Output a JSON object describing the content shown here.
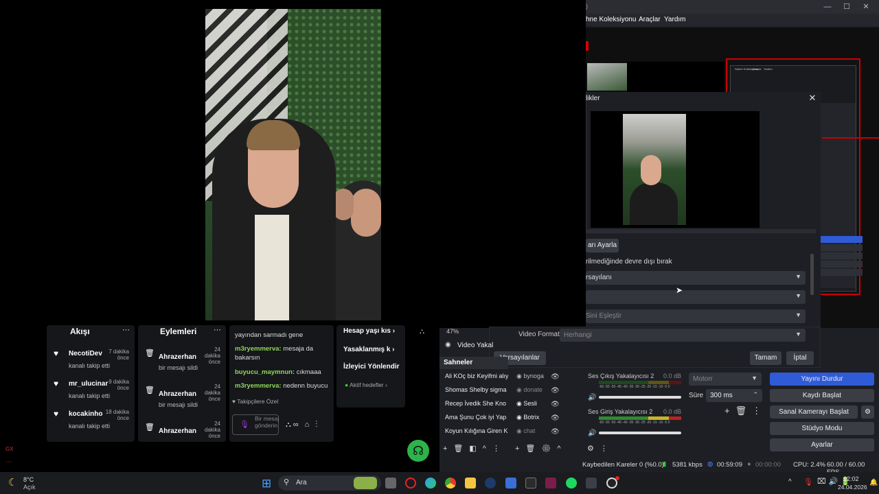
{
  "obs": {
    "menu": [
      "hne Koleksiyonu",
      "Araçlar",
      "Yardım"
    ],
    "window_controls": [
      "—",
      "☐",
      "✕"
    ],
    "nested_menu": [
      "Sahne Koleksiyonu",
      "Araçlar",
      "Yardım"
    ]
  },
  "dialog": {
    "title": "likler",
    "reset_button": "arı Ayarla",
    "checkbox_label": "rilmediğinde devre dışı bırak",
    "select1": "rsayılanı",
    "select2": "",
    "select3": "Sini Eşleştir",
    "video_format_label": "Video Formatı",
    "video_format_value": "Herhangi",
    "defaults_button": "Varsayılanlar",
    "ok_button": "Tamam",
    "cancel_button": "İptal"
  },
  "panels": {
    "follows": {
      "title": "Akışı",
      "items": [
        {
          "name": "NecotiDev",
          "action": "kanalı takip etti",
          "time": "7 dakika önce"
        },
        {
          "name": "mr_ulucinar",
          "action": "kanalı takip etti",
          "time": "9 dakika önce"
        },
        {
          "name": "kocakinho",
          "action": "kanalı takip etti",
          "time": "18 dakika önce"
        }
      ]
    },
    "actions": {
      "title": "Eylemleri",
      "items": [
        {
          "name": "Ahrazerhan",
          "action": "bir mesajı sildi",
          "time": "24 dakika önce"
        },
        {
          "name": "Ahrazerhan",
          "action": "bir mesajı sildi",
          "time": "24 dakika önce"
        },
        {
          "name": "Ahrazerhan",
          "action": "",
          "time": "24 dakika önce"
        }
      ]
    },
    "chat": {
      "messages": [
        {
          "user": "",
          "text": "yayından sarmadı gene"
        },
        {
          "user": "m3ryemmerva:",
          "text": "mesaja da bakarsın"
        },
        {
          "user": "buyucu_maymnun:",
          "text": "cıkmaaa"
        },
        {
          "user": "m3ryemmerva:",
          "text": "nedenn buyucu"
        }
      ],
      "followers_only": "Takipçilere Özel",
      "input_placeholder": "Bir mesaj gönderin"
    },
    "mod": {
      "items": [
        "Hesap yaşı kıs",
        "Yasaklanmış k",
        "İzleyici Yönlendir"
      ],
      "active_filters": "Aktif hedefler"
    }
  },
  "dock": {
    "preview_label": "Video Yakal",
    "scenes_title": "Sahneler",
    "scenes": [
      "Ali KOç biz Keyifmi alıy",
      "Shomas Shelby sigma",
      "Recep İvedik She Kno",
      "Ama Şunu Çok iyi Yap",
      "Koyun Kılığına Giren K"
    ],
    "sources": [
      "bynoga",
      "donate",
      "Sesli",
      "Botrix",
      "chat"
    ],
    "zoom": "47%",
    "mixer": [
      {
        "name": "Ses Çıkış Yakalayıcısı 2",
        "db": "0.0 dB"
      },
      {
        "name": "Ses Giriş Yakalayıcısı 2",
        "db": "0.0 dB"
      }
    ],
    "meter_ticks": "-60 -55 -50 -45 -40 -35 -30 -25 -20 -15 -10 -5 0",
    "transition": "Motorr",
    "duration_label": "Süre",
    "duration_value": "300 ms",
    "controls": [
      "Yayını Durdur",
      "Kaydı Başlat",
      "Sanal Kamerayı Başlat",
      "Stüdyo Modu",
      "Ayarlar"
    ]
  },
  "status": {
    "dropped": "Kaybedilen Kareler 0 (%0.0)",
    "bitrate": "5381 kbps",
    "live_time": "00:59:09",
    "rec_time": "00:00:00",
    "cpu": "CPU: 2.4%",
    "fps": "60.00 / 60.00 FPS"
  },
  "taskbar": {
    "weather_temp": "8°C",
    "weather_desc": "Açık",
    "search": "Ara",
    "time": "22:02",
    "date": "24.04.2026"
  },
  "side": {
    "gx": "GX"
  }
}
